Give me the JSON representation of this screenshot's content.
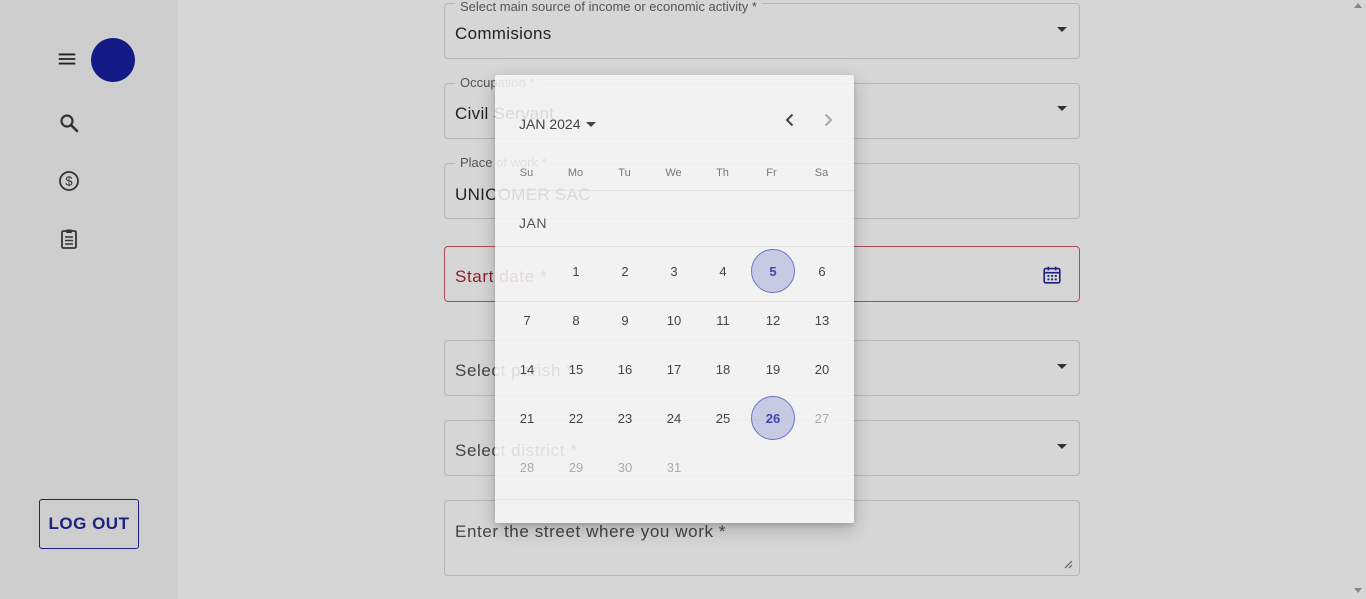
{
  "sidebar": {
    "logout_label": "LOG OUT",
    "icons": [
      "menu-icon",
      "search-icon",
      "dollar-icon",
      "clipboard-icon"
    ],
    "avatar_color": "#141a86"
  },
  "form": {
    "income_source": {
      "legend": "Select main source of income or economic activity *",
      "value": "Commisions"
    },
    "occupation": {
      "legend": "Occupation *",
      "value": "Civil Servant"
    },
    "place_of_work": {
      "legend": "Place of work *",
      "value": "UNICOMER SAC"
    },
    "start_date": {
      "placeholder": "Start date *"
    },
    "parish": {
      "placeholder": "Select parish *"
    },
    "district": {
      "placeholder": "Select district *"
    },
    "street": {
      "placeholder": "Enter the street where you work *"
    }
  },
  "datepicker": {
    "header": "JAN 2024",
    "month_name": "JAN",
    "weekdays": [
      "Su",
      "Mo",
      "Tu",
      "We",
      "Th",
      "Fr",
      "Sa"
    ],
    "weeks": [
      [
        "",
        "1",
        "2",
        "3",
        "4",
        "5",
        "6"
      ],
      [
        "7",
        "8",
        "9",
        "10",
        "11",
        "12",
        "13"
      ],
      [
        "14",
        "15",
        "16",
        "17",
        "18",
        "19",
        "20"
      ],
      [
        "21",
        "22",
        "23",
        "24",
        "25",
        "26",
        "27"
      ],
      [
        "28",
        "29",
        "30",
        "31",
        "",
        "",
        ""
      ]
    ],
    "highlighted_days": [
      "5",
      "26"
    ],
    "faded_days": [
      "27",
      "28",
      "29",
      "30",
      "31"
    ],
    "accent_color": "#3e47a8"
  },
  "colors": {
    "error": "#b04c5a",
    "brand": "#1c2380"
  }
}
